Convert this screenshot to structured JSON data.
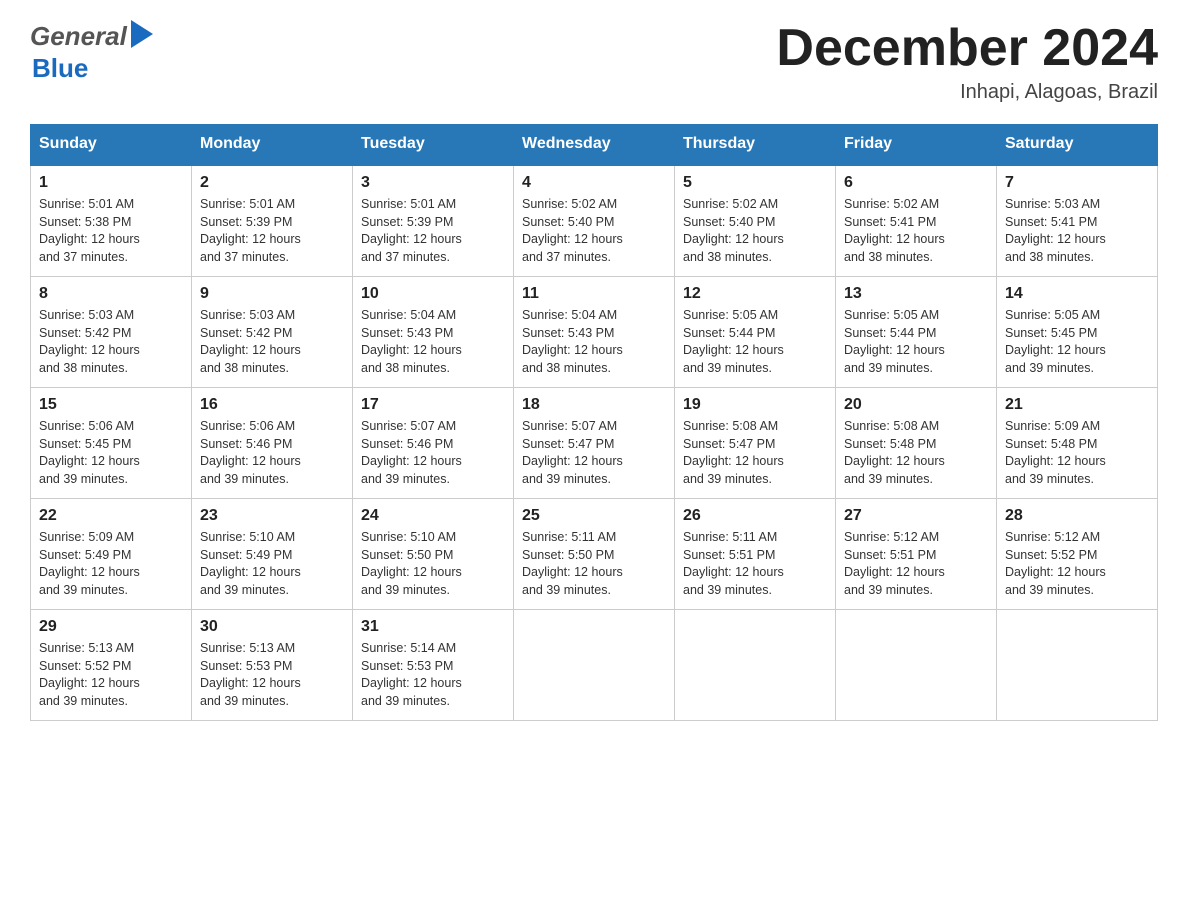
{
  "header": {
    "logo_general": "General",
    "logo_blue": "Blue",
    "title": "December 2024",
    "subtitle": "Inhapi, Alagoas, Brazil"
  },
  "days_of_week": [
    "Sunday",
    "Monday",
    "Tuesday",
    "Wednesday",
    "Thursday",
    "Friday",
    "Saturday"
  ],
  "weeks": [
    [
      {
        "day": "1",
        "sunrise": "5:01 AM",
        "sunset": "5:38 PM",
        "daylight": "12 hours and 37 minutes."
      },
      {
        "day": "2",
        "sunrise": "5:01 AM",
        "sunset": "5:39 PM",
        "daylight": "12 hours and 37 minutes."
      },
      {
        "day": "3",
        "sunrise": "5:01 AM",
        "sunset": "5:39 PM",
        "daylight": "12 hours and 37 minutes."
      },
      {
        "day": "4",
        "sunrise": "5:02 AM",
        "sunset": "5:40 PM",
        "daylight": "12 hours and 37 minutes."
      },
      {
        "day": "5",
        "sunrise": "5:02 AM",
        "sunset": "5:40 PM",
        "daylight": "12 hours and 38 minutes."
      },
      {
        "day": "6",
        "sunrise": "5:02 AM",
        "sunset": "5:41 PM",
        "daylight": "12 hours and 38 minutes."
      },
      {
        "day": "7",
        "sunrise": "5:03 AM",
        "sunset": "5:41 PM",
        "daylight": "12 hours and 38 minutes."
      }
    ],
    [
      {
        "day": "8",
        "sunrise": "5:03 AM",
        "sunset": "5:42 PM",
        "daylight": "12 hours and 38 minutes."
      },
      {
        "day": "9",
        "sunrise": "5:03 AM",
        "sunset": "5:42 PM",
        "daylight": "12 hours and 38 minutes."
      },
      {
        "day": "10",
        "sunrise": "5:04 AM",
        "sunset": "5:43 PM",
        "daylight": "12 hours and 38 minutes."
      },
      {
        "day": "11",
        "sunrise": "5:04 AM",
        "sunset": "5:43 PM",
        "daylight": "12 hours and 38 minutes."
      },
      {
        "day": "12",
        "sunrise": "5:05 AM",
        "sunset": "5:44 PM",
        "daylight": "12 hours and 39 minutes."
      },
      {
        "day": "13",
        "sunrise": "5:05 AM",
        "sunset": "5:44 PM",
        "daylight": "12 hours and 39 minutes."
      },
      {
        "day": "14",
        "sunrise": "5:05 AM",
        "sunset": "5:45 PM",
        "daylight": "12 hours and 39 minutes."
      }
    ],
    [
      {
        "day": "15",
        "sunrise": "5:06 AM",
        "sunset": "5:45 PM",
        "daylight": "12 hours and 39 minutes."
      },
      {
        "day": "16",
        "sunrise": "5:06 AM",
        "sunset": "5:46 PM",
        "daylight": "12 hours and 39 minutes."
      },
      {
        "day": "17",
        "sunrise": "5:07 AM",
        "sunset": "5:46 PM",
        "daylight": "12 hours and 39 minutes."
      },
      {
        "day": "18",
        "sunrise": "5:07 AM",
        "sunset": "5:47 PM",
        "daylight": "12 hours and 39 minutes."
      },
      {
        "day": "19",
        "sunrise": "5:08 AM",
        "sunset": "5:47 PM",
        "daylight": "12 hours and 39 minutes."
      },
      {
        "day": "20",
        "sunrise": "5:08 AM",
        "sunset": "5:48 PM",
        "daylight": "12 hours and 39 minutes."
      },
      {
        "day": "21",
        "sunrise": "5:09 AM",
        "sunset": "5:48 PM",
        "daylight": "12 hours and 39 minutes."
      }
    ],
    [
      {
        "day": "22",
        "sunrise": "5:09 AM",
        "sunset": "5:49 PM",
        "daylight": "12 hours and 39 minutes."
      },
      {
        "day": "23",
        "sunrise": "5:10 AM",
        "sunset": "5:49 PM",
        "daylight": "12 hours and 39 minutes."
      },
      {
        "day": "24",
        "sunrise": "5:10 AM",
        "sunset": "5:50 PM",
        "daylight": "12 hours and 39 minutes."
      },
      {
        "day": "25",
        "sunrise": "5:11 AM",
        "sunset": "5:50 PM",
        "daylight": "12 hours and 39 minutes."
      },
      {
        "day": "26",
        "sunrise": "5:11 AM",
        "sunset": "5:51 PM",
        "daylight": "12 hours and 39 minutes."
      },
      {
        "day": "27",
        "sunrise": "5:12 AM",
        "sunset": "5:51 PM",
        "daylight": "12 hours and 39 minutes."
      },
      {
        "day": "28",
        "sunrise": "5:12 AM",
        "sunset": "5:52 PM",
        "daylight": "12 hours and 39 minutes."
      }
    ],
    [
      {
        "day": "29",
        "sunrise": "5:13 AM",
        "sunset": "5:52 PM",
        "daylight": "12 hours and 39 minutes."
      },
      {
        "day": "30",
        "sunrise": "5:13 AM",
        "sunset": "5:53 PM",
        "daylight": "12 hours and 39 minutes."
      },
      {
        "day": "31",
        "sunrise": "5:14 AM",
        "sunset": "5:53 PM",
        "daylight": "12 hours and 39 minutes."
      },
      null,
      null,
      null,
      null
    ]
  ],
  "labels": {
    "sunrise": "Sunrise:",
    "sunset": "Sunset:",
    "daylight": "Daylight:"
  }
}
